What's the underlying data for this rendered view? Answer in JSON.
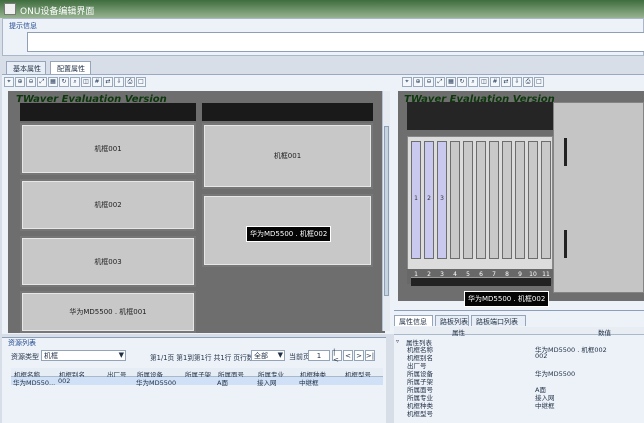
{
  "window": {
    "title": "ONU设备编辑界面"
  },
  "hint": {
    "label": "提示信息",
    "value": ""
  },
  "tabs": [
    "基本属性",
    "配置属性"
  ],
  "toolbar_icons": [
    "select-icon",
    "zoom-in-icon",
    "zoom-out-icon",
    "fit-icon",
    "layout-icon",
    "refresh-icon",
    "search-icon",
    "overview-icon",
    "grid-icon",
    "link-icon",
    "export-icon",
    "print-icon",
    "preview-icon"
  ],
  "left_canvas": {
    "watermark": "TWaver Evaluation Version",
    "frames": [
      "机框001",
      "机框002",
      "机框003",
      "华为MD5500 . 机框001"
    ],
    "middle_frames": [
      "机框001"
    ],
    "tooltip": "华为MD5500 . 机框002"
  },
  "right_canvas": {
    "watermark": "TWaver Evaluation Version",
    "card_labels": [
      "1",
      "2",
      "3"
    ],
    "slots": [
      "1",
      "2",
      "3",
      "4",
      "5",
      "6",
      "7",
      "8",
      "9",
      "10",
      "11"
    ],
    "tooltip": "华为MD5500 . 机框002"
  },
  "resources": {
    "title": "资源列表",
    "type_label": "资源类型",
    "type_value": "机框",
    "page_info": "第1/1页 第1到第1行 共1行  页行数",
    "page_size": "全部",
    "current_page_label": "当前页",
    "current_page": "1",
    "columns": [
      "机框名称",
      "机框别名",
      "出厂号",
      "所属设备",
      "所属子架",
      "所属面号",
      "所属专业",
      "机框种类",
      "机框型号"
    ],
    "rows": [
      [
        "华为MD550...",
        "002",
        "",
        "华为MD5500",
        "",
        "A面",
        "接入网",
        "中继框",
        ""
      ]
    ]
  },
  "properties": {
    "tabs": [
      "属性信息",
      "路板列表",
      "路板端口列表"
    ],
    "headers": [
      "属性",
      "数值"
    ],
    "section": "属性列表",
    "rows": [
      {
        "name": "机框名称",
        "value": "华为MD5500 . 机框002"
      },
      {
        "name": "机框别名",
        "value": "002"
      },
      {
        "name": "出厂号",
        "value": ""
      },
      {
        "name": "所属设备",
        "value": "华为MD5500"
      },
      {
        "name": "所属子架",
        "value": ""
      },
      {
        "name": "所属面号",
        "value": "A面"
      },
      {
        "name": "所属专业",
        "value": "接入网"
      },
      {
        "name": "机框种类",
        "value": "中继框"
      },
      {
        "name": "机框型号",
        "value": ""
      }
    ]
  }
}
